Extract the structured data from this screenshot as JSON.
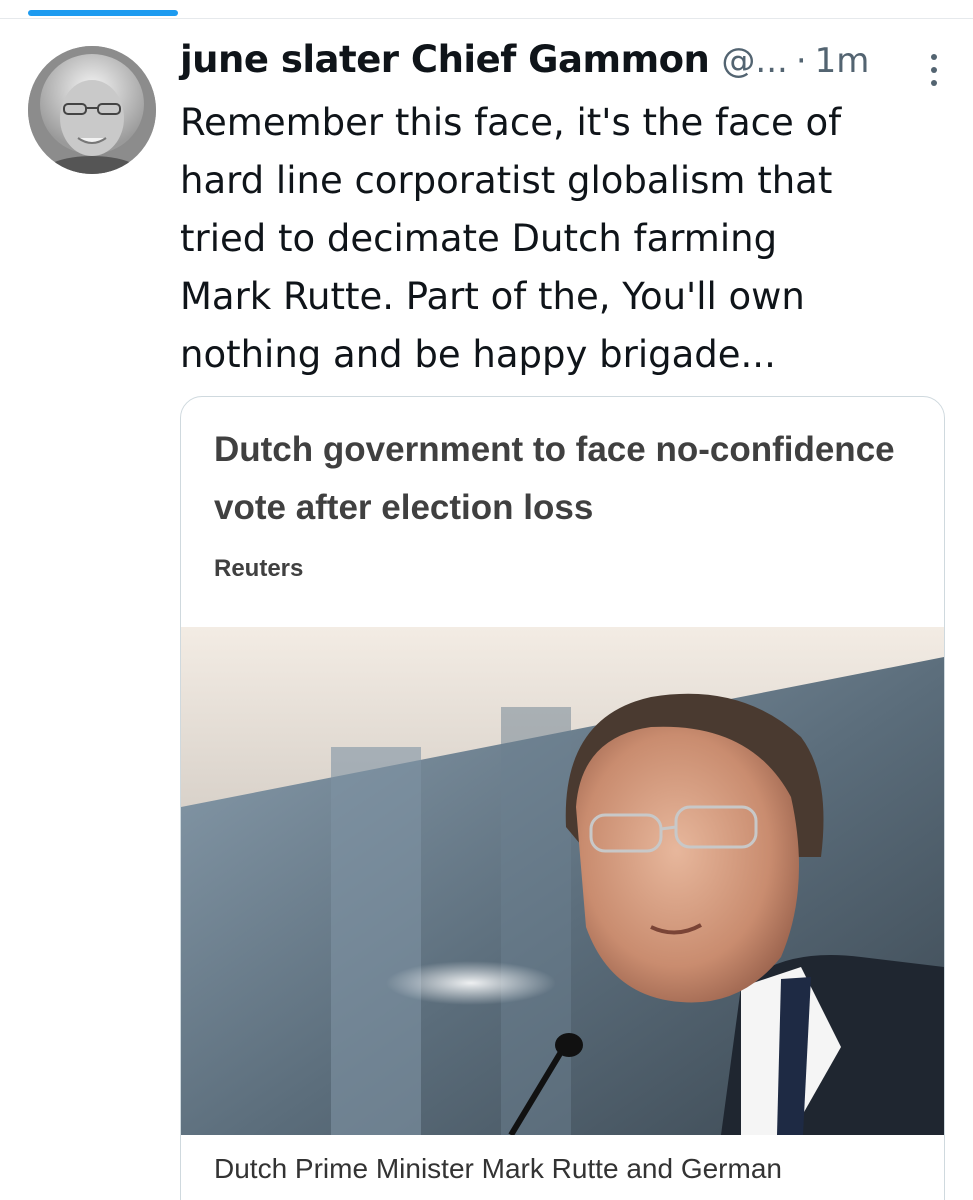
{
  "tweet": {
    "display_name": "june slater Chief Gammon",
    "handle": "@...",
    "separator": "·",
    "time": "1m",
    "text": "Remember this face, it's the face of\nhard line corporatist globalism that\ntried to decimate Dutch farming\nMark Rutte. Part of the, You'll own\nnothing and be happy brigade...",
    "more_icon": "more-vertical-icon"
  },
  "card": {
    "title": "Dutch government to face no-confidence vote after election loss",
    "source": "Reuters",
    "caption": "Dutch Prime Minister Mark Rutte and German"
  },
  "colors": {
    "accent": "#1d9bf0",
    "text_primary": "#0f1419",
    "text_secondary": "#536471",
    "card_border": "#cfd9de"
  }
}
